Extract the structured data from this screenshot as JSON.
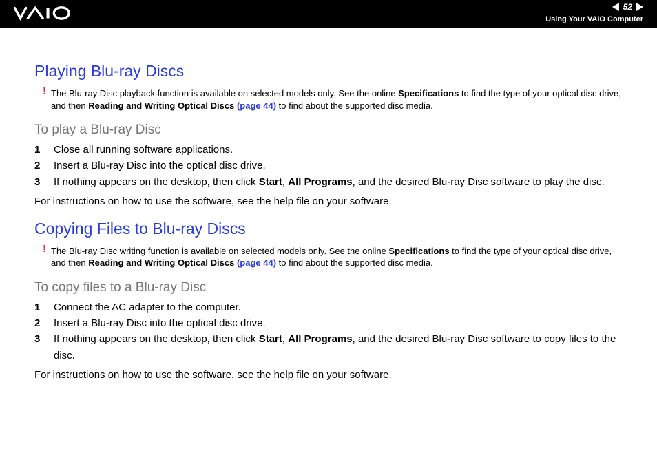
{
  "header": {
    "page_number": "52",
    "section": "Using Your VAIO Computer"
  },
  "section1": {
    "title": "Playing Blu-ray Discs",
    "note_pre": "The Blu-ray Disc playback function is available on selected models only. See the online ",
    "note_bold1": "Specifications",
    "note_mid": " to find the type of your optical disc drive, and then ",
    "note_bold2": "Reading and Writing Optical Discs ",
    "note_link": "(page 44)",
    "note_post": " to find about the supported disc media.",
    "subhead": "To play a Blu-ray Disc",
    "steps": [
      {
        "n": "1",
        "text": "Close all running software applications."
      },
      {
        "n": "2",
        "text": "Insert a Blu-ray Disc into the optical disc drive."
      },
      {
        "n": "3",
        "pre": "If nothing appears on the desktop, then click ",
        "b1": "Start",
        "sep": ", ",
        "b2": "All Programs",
        "post": ", and the desired Blu-ray Disc software to play the disc."
      }
    ],
    "after": "For instructions on how to use the software, see the help file on your software."
  },
  "section2": {
    "title": "Copying Files to Blu-ray Discs",
    "note_pre": "The Blu-ray Disc writing function is available on selected models only. See the online ",
    "note_bold1": "Specifications",
    "note_mid": " to find the type of your optical disc drive, and then ",
    "note_bold2": "Reading and Writing Optical Discs ",
    "note_link": "(page 44)",
    "note_post": " to find about the supported disc media.",
    "subhead": "To copy files to a Blu-ray Disc",
    "steps": [
      {
        "n": "1",
        "text": "Connect the AC adapter to the computer."
      },
      {
        "n": "2",
        "text": "Insert a Blu-ray Disc into the optical disc drive."
      },
      {
        "n": "3",
        "pre": "If nothing appears on the desktop, then click ",
        "b1": "Start",
        "sep": ", ",
        "b2": "All Programs",
        "post": ", and the desired Blu-ray Disc software to copy files to the disc."
      }
    ],
    "after": "For instructions on how to use the software, see the help file on your software."
  }
}
